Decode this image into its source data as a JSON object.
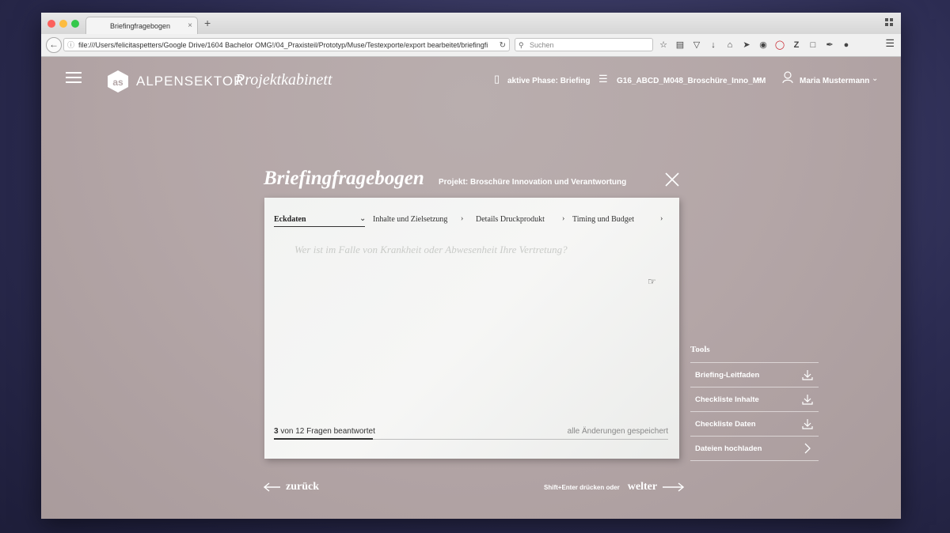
{
  "browser": {
    "tab_title": "Briefingfragebogen",
    "new_tab": "+",
    "tab_close": "×",
    "url": "file:///Users/felicitaspetters/Google Drive/1604 Bachelor OMG!/04_Praxisteil/Prototyp/Muse/Testexporte/export bearbeitet/briefingfi",
    "search_placeholder": "Suchen"
  },
  "header": {
    "brand": "ALPENSEKTOR",
    "product": "Projektkabinett",
    "phase": "aktive Phase: Briefing",
    "project_code": "G16_ABCD_M048_Broschüre_Inno_MM",
    "user": "Maria Mustermann"
  },
  "modal": {
    "title": "Briefingfragebogen",
    "project": "Projekt: Broschüre Innovation und Verantwortung",
    "steps": [
      "Eckdaten",
      "Inhalte und Zielsetzung",
      "Details Druckprodukt",
      "Timing und Budget"
    ],
    "question": "Wer ist im Falle von Krankheit oder Abwesenheit Ihre Vertretung?",
    "answered": "3",
    "answered_suffix": "von 12 Fragen beantwortet",
    "progress_fraction": 0.25,
    "saved": "alle Änderungen gespeichert",
    "back_label": "zurück",
    "next_hint": "Shift+Enter drücken oder",
    "next_label": "welter"
  },
  "tools": {
    "heading": "Tools",
    "items": [
      {
        "label": "Briefing-Leitfaden",
        "icon": "download-icon"
      },
      {
        "label": "Checkliste Inhalte",
        "icon": "download-icon"
      },
      {
        "label": "Checkliste Daten",
        "icon": "download-icon"
      },
      {
        "label": "Dateien hochladen",
        "icon": "chevron-right-icon"
      }
    ]
  },
  "colors": {
    "page_bg": "#b4a6a7",
    "card_bg": "#f3f4f3",
    "text_dark": "#333333",
    "white": "#ffffff"
  }
}
